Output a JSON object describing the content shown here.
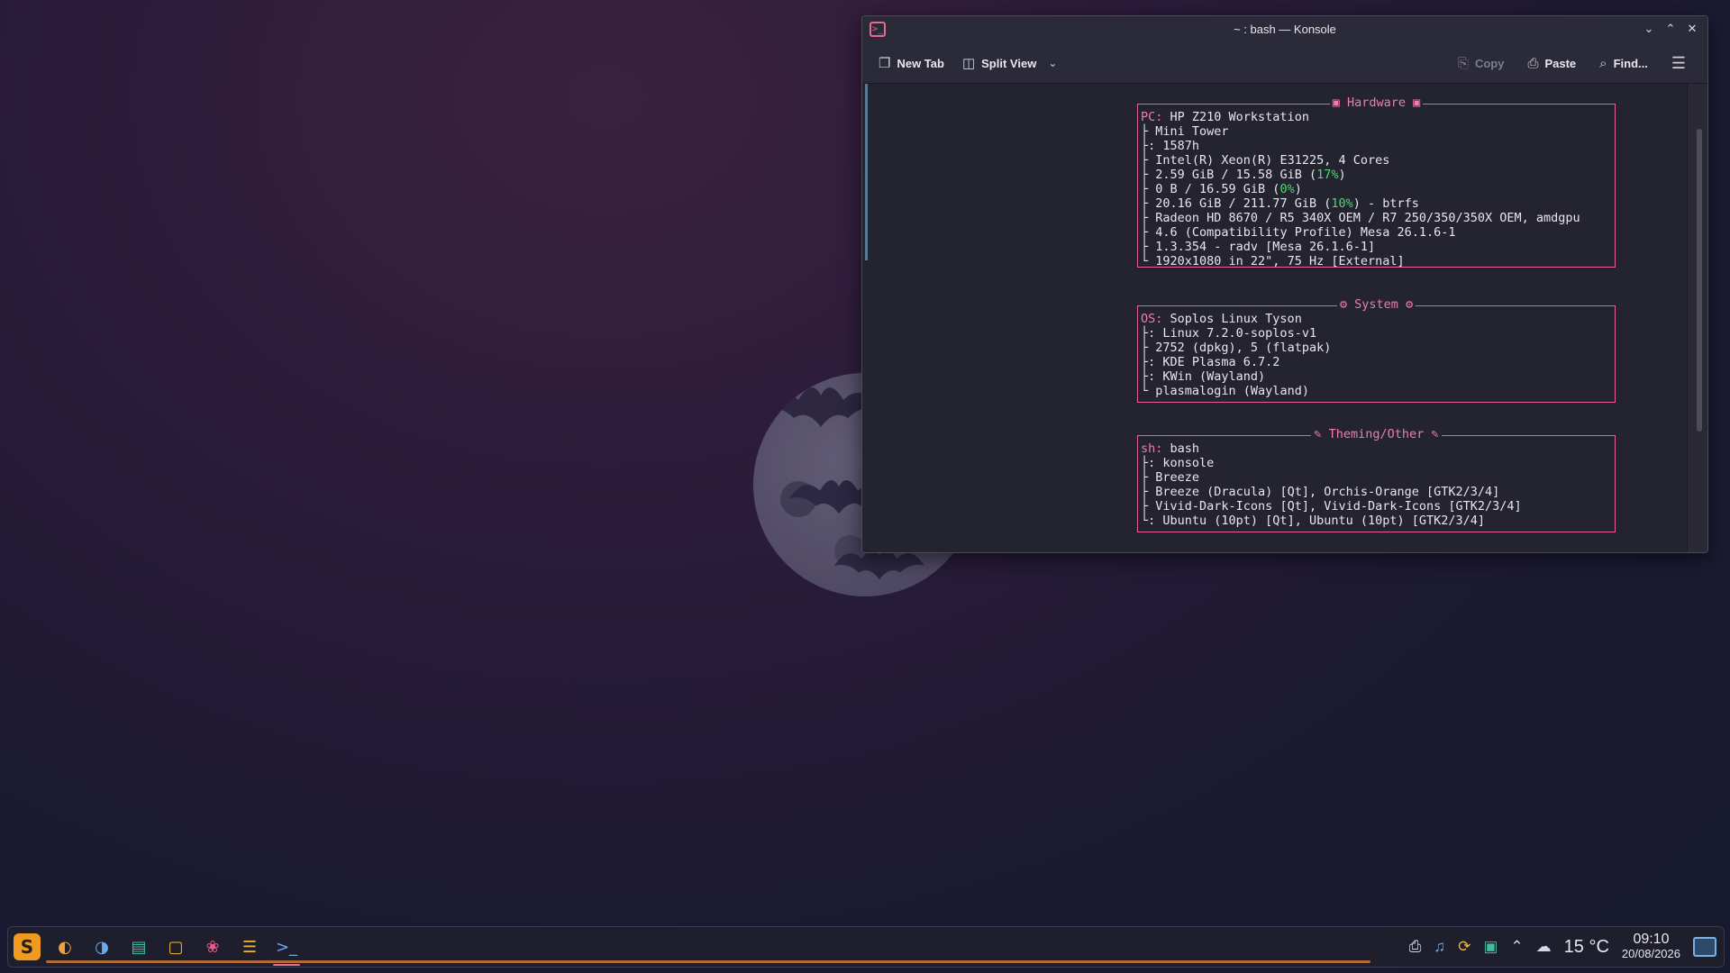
{
  "window": {
    "title": "~ : bash — Konsole",
    "toolbar": {
      "new_tab": "New Tab",
      "split_view": "Split View",
      "copy": "Copy",
      "paste": "Paste",
      "find": "Find..."
    }
  },
  "fastfetch": {
    "hardware": {
      "header": "Hardware",
      "rows": [
        {
          "key": "PC:",
          "value": " HP Z210 Workstation"
        },
        {
          "key": "├",
          "value": " Mini Tower"
        },
        {
          "key": "├:",
          "value": " 1587h"
        },
        {
          "key": "├",
          "value": " Intel(R) Xeon(R) E31225, 4 Cores"
        },
        {
          "key": "├",
          "value_a": " 2.59 GiB / 15.58 GiB (",
          "pct": "17%",
          "value_b": ")"
        },
        {
          "key": "├",
          "value_a": " 0 B / 16.59 GiB (",
          "pct": "0%",
          "value_b": ")"
        },
        {
          "key": "├",
          "value_a": " 20.16 GiB / 211.77 GiB (",
          "pct": "10%",
          "value_b": ") - btrfs"
        },
        {
          "key": "├",
          "value": " Radeon HD 8670 / R5 340X OEM / R7 250/350/350X OEM, amdgpu"
        },
        {
          "key": "├",
          "value": " 4.6 (Compatibility Profile) Mesa 26.1.6-1"
        },
        {
          "key": "├",
          "value": " 1.3.354 - radv [Mesa 26.1.6-1]"
        },
        {
          "key": "└",
          "value": " 1920x1080 in 22\", 75 Hz [External]"
        }
      ]
    },
    "system": {
      "header": "System",
      "rows": [
        {
          "key": "OS:",
          "value": " Soplos Linux Tyson"
        },
        {
          "key": "├:",
          "value": " Linux 7.2.0-soplos-v1"
        },
        {
          "key": "├",
          "value": " 2752 (dpkg), 5 (flatpak)"
        },
        {
          "key": "├:",
          "value": " KDE Plasma 6.7.2"
        },
        {
          "key": "├:",
          "value": " KWin (Wayland)"
        },
        {
          "key": "└",
          "value": " plasmalogin (Wayland)"
        }
      ]
    },
    "theming": {
      "header": "Theming/Other",
      "rows": [
        {
          "key": "sh:",
          "value": " bash"
        },
        {
          "key": "├:",
          "value": " konsole"
        },
        {
          "key": "├",
          "value": " Breeze"
        },
        {
          "key": "├",
          "value": " Breeze (Dracula) [Qt], Orchis-Orange [GTK2/3/4]"
        },
        {
          "key": "├",
          "value": " Vivid-Dark-Icons [Qt], Vivid-Dark-Icons [GTK2/3/4]"
        },
        {
          "key": "└:",
          "value": " Ubuntu (10pt) [Qt], Ubuntu (10pt) [GTK2/3/4]"
        }
      ]
    }
  },
  "taskbar": {
    "apps": [
      "launcher-icon",
      "firefox-icon",
      "thunderbird-icon",
      "file-manager-icon",
      "discord-icon",
      "app-store-icon",
      "text-editor-icon",
      "konsole-icon"
    ],
    "weather_temp": "15 °C",
    "clock_time": "09:10",
    "clock_date": "20/08/2026"
  },
  "colors": {
    "accent_pink": "#e3609a",
    "percent_green": "#50d67c",
    "taskbar_orange": "#c97a3a"
  }
}
